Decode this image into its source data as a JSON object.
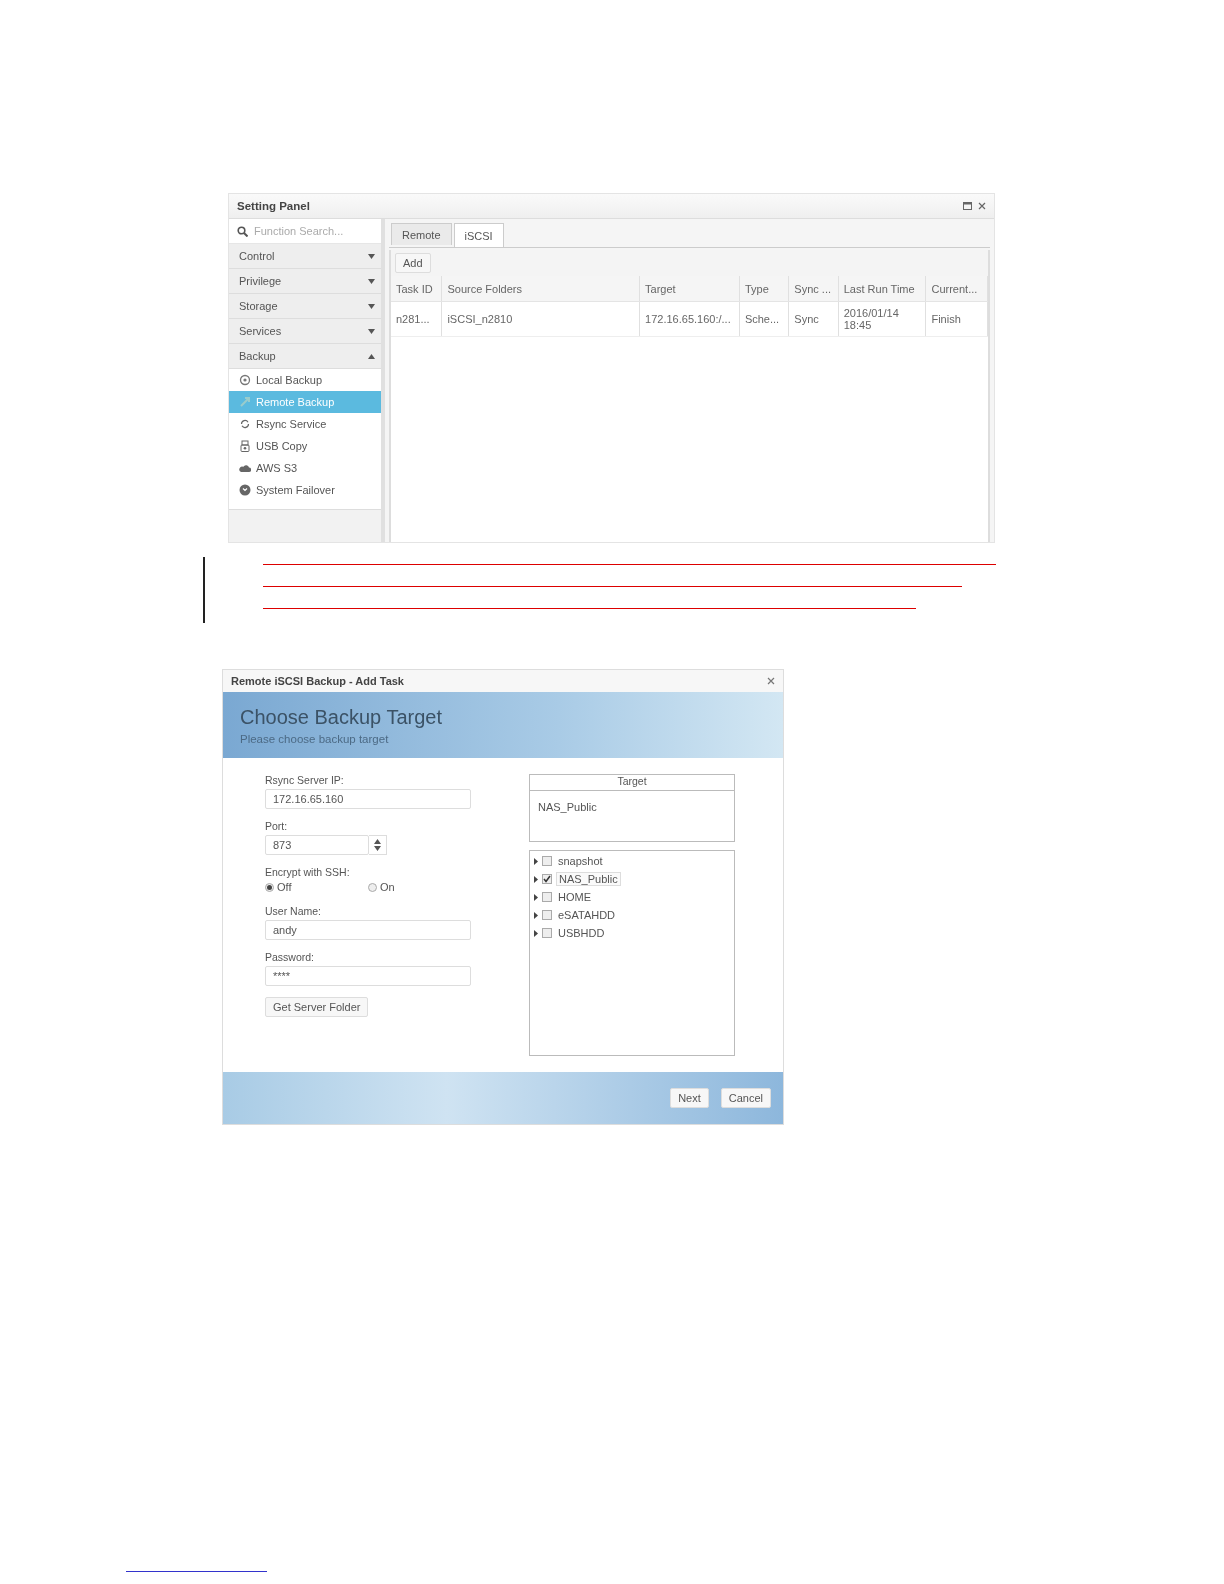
{
  "setting_panel": {
    "title": "Setting Panel",
    "search": {
      "placeholder": "Function Search..."
    },
    "categories": [
      {
        "label": "Control",
        "expanded": false
      },
      {
        "label": "Privilege",
        "expanded": false
      },
      {
        "label": "Storage",
        "expanded": false
      },
      {
        "label": "Services",
        "expanded": false
      },
      {
        "label": "Backup",
        "expanded": true,
        "children": [
          {
            "label": "Local Backup",
            "kind": "local",
            "selected": false
          },
          {
            "label": "Remote Backup",
            "kind": "remote",
            "selected": true
          },
          {
            "label": "Rsync Service",
            "kind": "rsync",
            "selected": false
          },
          {
            "label": "USB Copy",
            "kind": "usb",
            "selected": false
          },
          {
            "label": "AWS S3",
            "kind": "cloud",
            "selected": false
          },
          {
            "label": "System Failover",
            "kind": "failover",
            "selected": false
          }
        ]
      }
    ],
    "tabs": [
      {
        "label": "Remote",
        "selected": false
      },
      {
        "label": "iSCSI",
        "selected": true
      }
    ],
    "add_button": "Add",
    "table": {
      "columns": [
        "Task ID",
        "Source Folders",
        "Target",
        "Type",
        "Sync ...",
        "Last Run Time",
        "Current..."
      ],
      "rows": [
        [
          "n281...",
          "iSCSI_n2810",
          "172.16.65.160:/...",
          "Sche...",
          "Sync",
          "2016/01/14 18:45",
          "Finish"
        ]
      ]
    }
  },
  "add_task_dialog": {
    "title": "Remote iSCSI Backup - Add Task",
    "heading": "Choose Backup Target",
    "subheading": "Please choose backup target",
    "server_ip": {
      "label": "Rsync Server IP:",
      "value": "172.16.65.160"
    },
    "port": {
      "label": "Port:",
      "value": "873"
    },
    "encrypt": {
      "label": "Encrypt with SSH:",
      "options": [
        {
          "label": "Off",
          "selected": true
        },
        {
          "label": "On",
          "selected": false
        }
      ]
    },
    "user_name": {
      "label": "User Name:",
      "value": "andy"
    },
    "password": {
      "label": "Password:",
      "value": "****"
    },
    "get_folder_button": "Get Server Folder",
    "target": {
      "header": "Target",
      "value": "NAS_Public"
    },
    "folders": [
      {
        "label": "snapshot",
        "checked": false
      },
      {
        "label": "NAS_Public",
        "checked": true
      },
      {
        "label": "HOME",
        "checked": false
      },
      {
        "label": "eSATAHDD",
        "checked": false
      },
      {
        "label": "USBHDD",
        "checked": false
      }
    ],
    "buttons": [
      "Next",
      "Cancel"
    ]
  }
}
